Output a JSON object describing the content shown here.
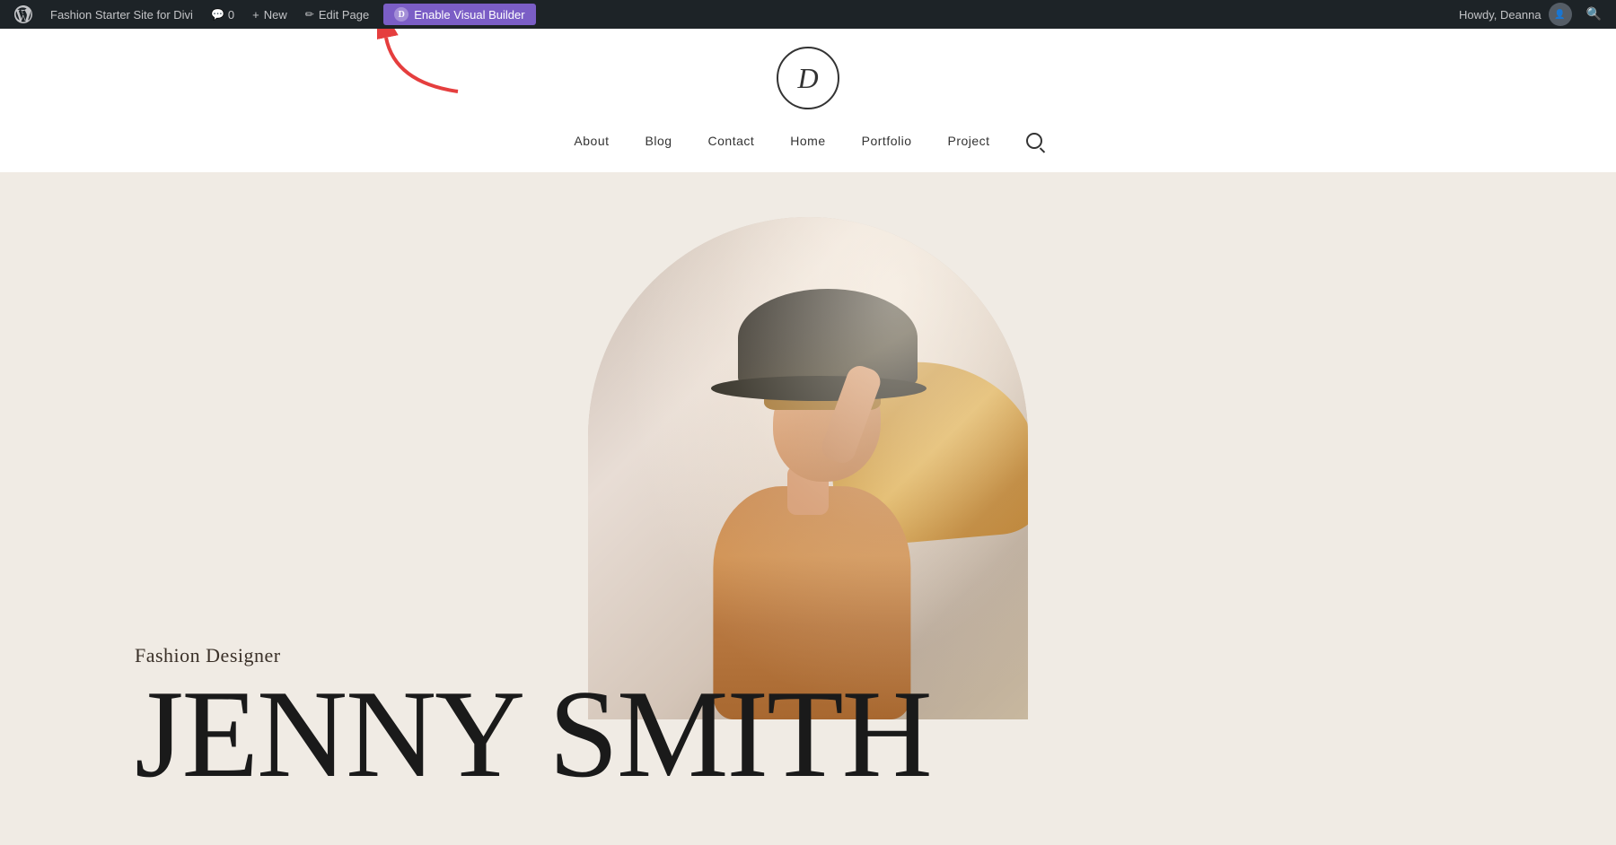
{
  "admin_bar": {
    "site_name": "Fashion Starter Site for Divi",
    "comment_count": "0",
    "new_label": "New",
    "edit_label": "Edit Page",
    "enable_builder_label": "Enable Visual Builder",
    "divi_letter": "D",
    "howdy": "Howdy, Deanna"
  },
  "site": {
    "logo_letter": "D",
    "nav_items": [
      {
        "label": "About"
      },
      {
        "label": "Blog"
      },
      {
        "label": "Contact"
      },
      {
        "label": "Home"
      },
      {
        "label": "Portfolio"
      },
      {
        "label": "Project"
      }
    ]
  },
  "hero": {
    "subtitle": "Fashion Designer",
    "title": "JENNY SMITH"
  },
  "colors": {
    "admin_bar_bg": "#1d2327",
    "admin_bar_text": "#c3c4c7",
    "enable_builder_bg": "#7b5ec6",
    "hero_bg": "#f0ebe4",
    "nav_text": "#333333",
    "hero_title_color": "#1a1a1a",
    "hero_subtitle_color": "#3a3028"
  }
}
